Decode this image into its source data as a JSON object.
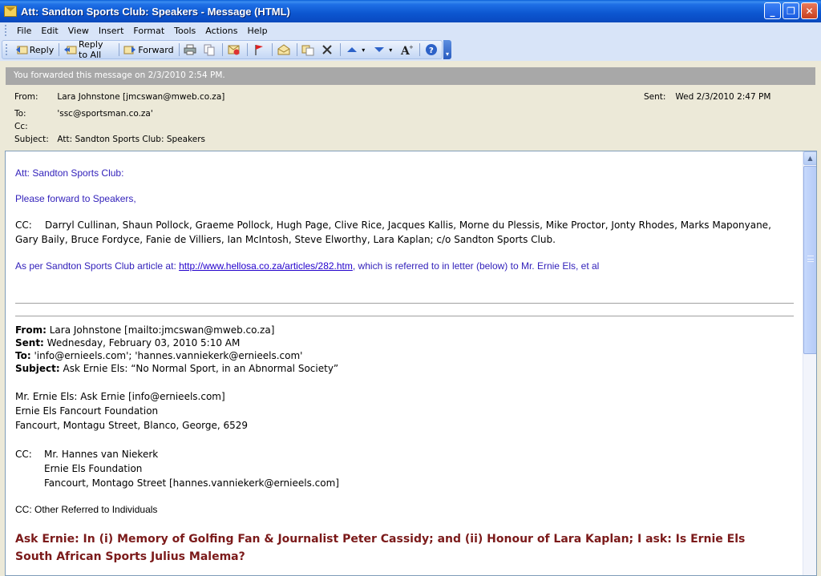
{
  "window": {
    "title": "Att: Sandton Sports Club: Speakers - Message (HTML)",
    "buttons": [
      "_",
      "❐",
      "✕"
    ]
  },
  "menu": [
    {
      "label": "File"
    },
    {
      "label": "Edit"
    },
    {
      "label": "View"
    },
    {
      "label": "Insert"
    },
    {
      "label": "Format"
    },
    {
      "label": "Tools"
    },
    {
      "label": "Actions"
    },
    {
      "label": "Help"
    }
  ],
  "toolbar": {
    "reply": "Reply",
    "reply_all": "Reply to All",
    "forward": "Forward"
  },
  "info_banner": "You forwarded this message on 2/3/2010 2:54 PM.",
  "headers": {
    "from_label": "From:",
    "from": "Lara Johnstone [jmcswan@mweb.co.za]",
    "to_label": "To:",
    "to": "'ssc@sportsman.co.za'",
    "cc_label": "Cc:",
    "cc": "",
    "subject_label": "Subject:",
    "subject": "Att: Sandton Sports Club: Speakers",
    "sent_label": "Sent:",
    "sent": "Wed 2/3/2010 2:47 PM"
  },
  "body": {
    "line1": "Att: Sandton Sports Club:",
    "line2": "Please forward to Speakers,",
    "cc_prefix": "CC:",
    "cc_names": "Darryl Cullinan, Shaun Pollock, Graeme Pollock, Hugh Page, Clive Rice, Jacques Kallis, Morne du Plessis, Mike Proctor, Jonty Rhodes, Marks Maponyane, Gary Baily, Bruce Fordyce, Fanie de Villiers, Ian McIntosh, Steve Elworthy, Lara Kaplan; c/o Sandton Sports Club.",
    "article_prefix": "As per Sandton Sports Club article at: ",
    "article_link": "http://www.hellosa.co.za/articles/282.htm",
    "article_suffix": ", which is referred to in letter (below) to Mr. Ernie Els, et al",
    "fwd": {
      "from_label": "From:",
      "from": " Lara Johnstone [mailto:jmcswan@mweb.co.za]",
      "sent_label": "Sent:",
      "sent": " Wednesday, February 03, 2010 5:10 AM",
      "to_label": "To:",
      "to": " 'info@ernieels.com'; 'hannes.vanniekerk@ernieels.com'",
      "subject_label": "Subject:",
      "subject": " Ask Ernie Els: “No Normal Sport, in an Abnormal Society”"
    },
    "address1": "Mr. Ernie Els: Ask Ernie [info@ernieels.com]",
    "address2": "Ernie Els Fancourt Foundation",
    "address3": "Fancourt, Montagu Street, Blanco, George, 6529",
    "cc2_label": "CC:",
    "cc2_line1": "Mr. Hannes van Niekerk",
    "cc2_line2": "Ernie Els Foundation",
    "cc2_line3": "Fancourt, Montago Street [hannes.vanniekerk@ernieels.com]",
    "cc3": "CC: Other Referred to Individuals",
    "heading": "Ask Ernie: In (i) Memory of Golfing Fan & Journalist Peter Cassidy; and (ii) Honour of Lara Kaplan; I ask: Is Ernie Els South African Sports Julius Malema?"
  },
  "colors": {
    "title_bar": "#0c56d0",
    "body_text_blue": "#3322bb",
    "heading_red": "#7b1a1a",
    "banner_gray": "#a8a8a8"
  }
}
